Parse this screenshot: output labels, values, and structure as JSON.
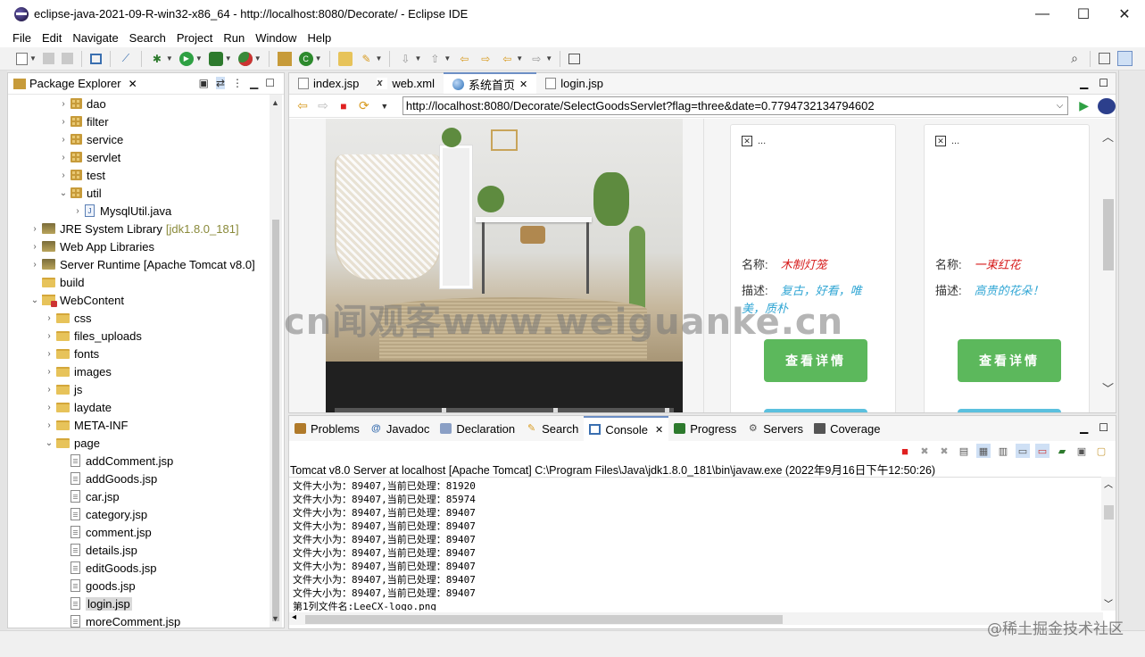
{
  "window": {
    "title": "eclipse-java-2021-09-R-win32-x86_64 - http://localhost:8080/Decorate/ - Eclipse IDE",
    "controls": {
      "minimize": "—",
      "maximize": "☐",
      "close": "✕"
    }
  },
  "menu": [
    "File",
    "Edit",
    "Navigate",
    "Search",
    "Project",
    "Run",
    "Window",
    "Help"
  ],
  "package_explorer": {
    "title": "Package Explorer",
    "tree": [
      {
        "label": "dao",
        "icon": "package",
        "expanded": false,
        "indent": 2
      },
      {
        "label": "filter",
        "icon": "package",
        "expanded": false,
        "indent": 2
      },
      {
        "label": "service",
        "icon": "package",
        "expanded": false,
        "indent": 2
      },
      {
        "label": "servlet",
        "icon": "package",
        "expanded": false,
        "indent": 2
      },
      {
        "label": "test",
        "icon": "package",
        "expanded": false,
        "indent": 2
      },
      {
        "label": "util",
        "icon": "package",
        "expanded": true,
        "indent": 2
      },
      {
        "label": "MysqlUtil.java",
        "icon": "java",
        "expanded": false,
        "indent": 3
      },
      {
        "label": "JRE System Library",
        "decoration": "[jdk1.8.0_181]",
        "icon": "library",
        "expanded": false,
        "indent": 0
      },
      {
        "label": "Web App Libraries",
        "icon": "library",
        "expanded": false,
        "indent": 0
      },
      {
        "label": "Server Runtime [Apache Tomcat v8.0]",
        "icon": "library",
        "expanded": false,
        "indent": 0
      },
      {
        "label": "build",
        "icon": "folder",
        "noarrow": true,
        "indent": 0
      },
      {
        "label": "WebContent",
        "icon": "project",
        "expanded": true,
        "indent": 0
      },
      {
        "label": "css",
        "icon": "folder",
        "expanded": false,
        "indent": 1
      },
      {
        "label": "files_uploads",
        "icon": "folder",
        "expanded": false,
        "indent": 1
      },
      {
        "label": "fonts",
        "icon": "folder",
        "expanded": false,
        "indent": 1
      },
      {
        "label": "images",
        "icon": "folder",
        "expanded": false,
        "indent": 1
      },
      {
        "label": "js",
        "icon": "folder",
        "expanded": false,
        "indent": 1
      },
      {
        "label": "laydate",
        "icon": "folder",
        "expanded": false,
        "indent": 1
      },
      {
        "label": "META-INF",
        "icon": "folder",
        "expanded": false,
        "indent": 1
      },
      {
        "label": "page",
        "icon": "folder",
        "expanded": true,
        "indent": 1
      },
      {
        "label": "addComment.jsp",
        "icon": "file",
        "indent": 2,
        "noarrow": true
      },
      {
        "label": "addGoods.jsp",
        "icon": "file",
        "indent": 2,
        "noarrow": true
      },
      {
        "label": "car.jsp",
        "icon": "file",
        "indent": 2,
        "noarrow": true
      },
      {
        "label": "category.jsp",
        "icon": "file",
        "indent": 2,
        "noarrow": true
      },
      {
        "label": "comment.jsp",
        "icon": "file",
        "indent": 2,
        "noarrow": true
      },
      {
        "label": "details.jsp",
        "icon": "file",
        "indent": 2,
        "noarrow": true
      },
      {
        "label": "editGoods.jsp",
        "icon": "file",
        "indent": 2,
        "noarrow": true
      },
      {
        "label": "goods.jsp",
        "icon": "file",
        "indent": 2,
        "noarrow": true
      },
      {
        "label": "login.jsp",
        "icon": "file",
        "indent": 2,
        "noarrow": true,
        "selected": true
      },
      {
        "label": "moreComment.jsp",
        "icon": "file",
        "indent": 2,
        "noarrow": true
      }
    ]
  },
  "editor": {
    "tabs": [
      {
        "label": "index.jsp",
        "icon": "file"
      },
      {
        "label": "web.xml",
        "icon": "xml"
      },
      {
        "label": "系统首页",
        "icon": "globe",
        "active": true,
        "closable": true
      },
      {
        "label": "login.jsp",
        "icon": "file"
      }
    ],
    "close_glyph": "✕",
    "url": "http://localhost:8080/Decorate/SelectGoodsServlet?flag=three&date=0.7794732134794602"
  },
  "products": [
    {
      "broken_alt": "...",
      "name_label": "名称:",
      "name": "木制灯笼",
      "desc_label": "描述:",
      "desc": "复古，好看，唯美，质朴",
      "button": "查看详情"
    },
    {
      "broken_alt": "...",
      "name_label": "名称:",
      "name": "一束红花",
      "desc_label": "描述:",
      "desc": "高贵的花朵！",
      "button": "查看详情"
    }
  ],
  "watermark": "cn闻观客www.weiguanke.cn",
  "console": {
    "tabs": [
      {
        "label": "Problems",
        "icon": "problems"
      },
      {
        "label": "Javadoc",
        "icon": "at"
      },
      {
        "label": "Declaration",
        "icon": "decl"
      },
      {
        "label": "Search",
        "icon": "search"
      },
      {
        "label": "Console",
        "icon": "console",
        "active": true,
        "closable": true
      },
      {
        "label": "Progress",
        "icon": "progress"
      },
      {
        "label": "Servers",
        "icon": "servers"
      },
      {
        "label": "Coverage",
        "icon": "coverage"
      }
    ],
    "description": "Tomcat v8.0 Server at localhost [Apache Tomcat] C:\\Program Files\\Java\\jdk1.8.0_181\\bin\\javaw.exe  (2022年9月16日下午12:50:26)",
    "lines": [
      "文件大小为：89407,当前已处理：81920",
      "文件大小为：89407,当前已处理：85974",
      "文件大小为：89407,当前已处理：89407",
      "文件大小为：89407,当前已处理：89407",
      "文件大小为：89407,当前已处理：89407",
      "文件大小为：89407,当前已处理：89407",
      "文件大小为：89407,当前已处理：89407",
      "文件大小为：89407,当前已处理：89407",
      "文件大小为：89407,当前已处理：89407",
      "第1列文件名:LeeCX-logo.png"
    ]
  },
  "juejin_watermark": "@稀土掘金技术社区"
}
